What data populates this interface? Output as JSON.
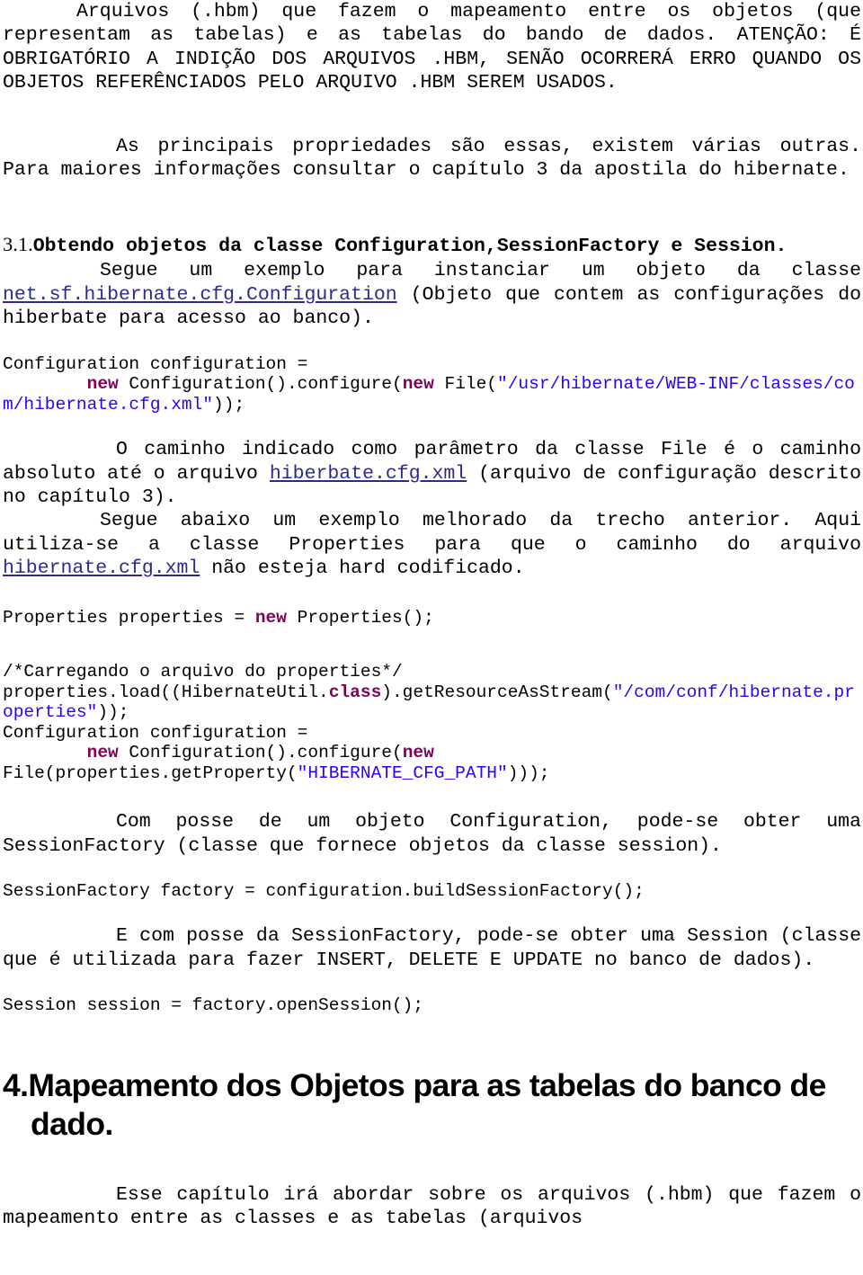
{
  "document": {
    "type": "apostila-page",
    "language": "pt-BR",
    "topic": "Hibernate",
    "colors": {
      "text": "#000000",
      "background": "#ffffff",
      "link": "#2b2b8f",
      "code_keyword": "#7f0055",
      "code_string": "#2a00ff"
    }
  },
  "blocks": {
    "p_intro_continuation": {
      "line1": "Arquivos (.hbm) que fazem o mapeamento entre os objetos (que representam as tabelas) e as tabelas do bando de dados. ATENÇÃO: É OBRIGATÓRIO A INDIÇÃO DOS ARQUIVOS .HBM, SENÃO OCORRERÁ ERRO QUANDO OS OBJETOS REFERÊNCIADOS PELO ARQUIVO .HBM SEREM USADOS."
    },
    "p_principais": {
      "text": "As principais propriedades são essas, existem várias outras. Para maiores informações consultar o capítulo 3 da apostila do hibernate."
    },
    "heading_3_1": {
      "number": "3.1.",
      "title": "Obtendo objetos da classe Configuration,SessionFactory e Session."
    },
    "p_segue_exemplo": {
      "before_link": "Segue um exemplo para instanciar um objeto da classe ",
      "link": "net.sf.hibernate.cfg.Configuration",
      "after_link": " (Objeto que contem as configurações do hiberbate para acesso ao banco)."
    },
    "code_block_1": {
      "tokens": [
        {
          "t": "Configuration configuration =\n        ",
          "k": "plain"
        },
        {
          "t": "new",
          "k": "keyword"
        },
        {
          "t": " Configuration().configure(",
          "k": "plain"
        },
        {
          "t": "new",
          "k": "keyword"
        },
        {
          "t": " File(",
          "k": "plain"
        },
        {
          "t": "\"/usr/hibernate/WEB-INF/classes/com/hibernate.cfg.xml\"",
          "k": "string"
        },
        {
          "t": "));",
          "k": "plain"
        }
      ]
    },
    "p_caminho": {
      "before_link": "O caminho indicado como parâmetro da classe File é o caminho absoluto até o arquivo ",
      "link": "hiberbate.cfg.xml",
      "after_link": " (arquivo de configuração descrito no capítulo 3)."
    },
    "p_segue_melhorado": {
      "before_link": "Segue abaixo um exemplo melhorado da trecho anterior. Aqui utiliza-se a classe Properties para que o caminho do arquivo ",
      "link": "hibernate.cfg.xml",
      "after_link": " não esteja hard codificado."
    },
    "code_block_2": {
      "tokens": [
        {
          "t": "Properties properties = ",
          "k": "plain"
        },
        {
          "t": "new",
          "k": "keyword"
        },
        {
          "t": " Properties();",
          "k": "plain"
        }
      ]
    },
    "code_block_3": {
      "tokens": [
        {
          "t": "/*Carregando o arquivo do properties*/\nproperties.load((HibernateUtil.",
          "k": "plain"
        },
        {
          "t": "class",
          "k": "keyword"
        },
        {
          "t": ").getResourceAsStream(",
          "k": "plain"
        },
        {
          "t": "\"/com/conf/hibernate.properties\"",
          "k": "string"
        },
        {
          "t": "));\nConfiguration configuration =\n        ",
          "k": "plain"
        },
        {
          "t": "new",
          "k": "keyword"
        },
        {
          "t": " Configuration().configure(",
          "k": "plain"
        },
        {
          "t": "new",
          "k": "keyword"
        },
        {
          "t": "\nFile(properties.getProperty(",
          "k": "plain"
        },
        {
          "t": "\"HIBERNATE_CFG_PATH\"",
          "k": "string"
        },
        {
          "t": ")));",
          "k": "plain"
        }
      ]
    },
    "p_com_posse": {
      "text": "Com posse de um objeto Configuration, pode-se obter uma SessionFactory (classe que fornece objetos da classe session)."
    },
    "code_block_4": {
      "tokens": [
        {
          "t": "SessionFactory factory = configuration.buildSessionFactory();",
          "k": "plain"
        }
      ]
    },
    "p_e_com_posse": {
      "text": "E com posse da SessionFactory, pode-se obter uma Session (classe que é utilizada para fazer INSERT, DELETE E UPDATE no banco de dados)."
    },
    "code_block_5": {
      "tokens": [
        {
          "t": "Session session = factory.openSession();",
          "k": "plain"
        }
      ]
    },
    "heading_4": {
      "number": "4.",
      "title": "Mapeamento dos Objetos para as tabelas do banco de dado."
    },
    "p_esse_capitulo": {
      "text": "Esse capítulo irá abordar sobre os arquivos (.hbm) que fazem o mapeamento entre as classes e as tabelas (arquivos"
    }
  }
}
